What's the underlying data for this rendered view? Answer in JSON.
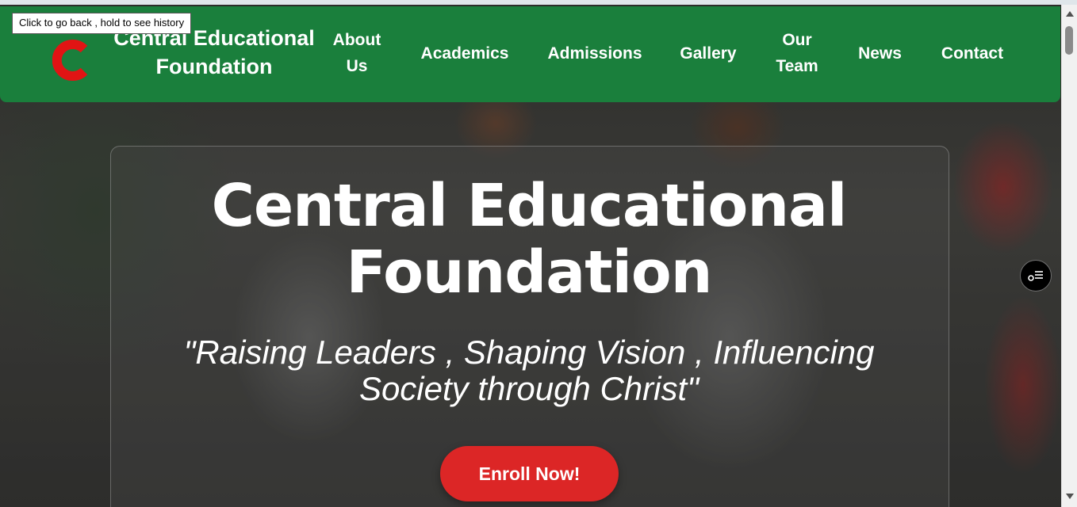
{
  "tooltip": {
    "text": "Click to go back , hold to see history"
  },
  "brand": {
    "line1": "Central Educational",
    "line2": "Foundation"
  },
  "nav": {
    "about": [
      "About",
      "Us"
    ],
    "academics": "Academics",
    "admissions": "Admissions",
    "gallery": "Gallery",
    "our_team": [
      "Our",
      "Team"
    ],
    "news": "News",
    "contact": "Contact"
  },
  "hero": {
    "title_line1": "Central Educational",
    "title_line2": "Foundation",
    "tagline_line1": "\"Raising Leaders , Shaping Vision , Influencing",
    "tagline_line2": "Society through Christ\"",
    "cta": "Enroll Now!"
  },
  "colors": {
    "navbar": "#1a7f3c",
    "logo": "#e11414",
    "cta": "#dc2626"
  },
  "icons": {
    "logo": "c-letter-logo",
    "float_button": "list-settings-icon"
  }
}
